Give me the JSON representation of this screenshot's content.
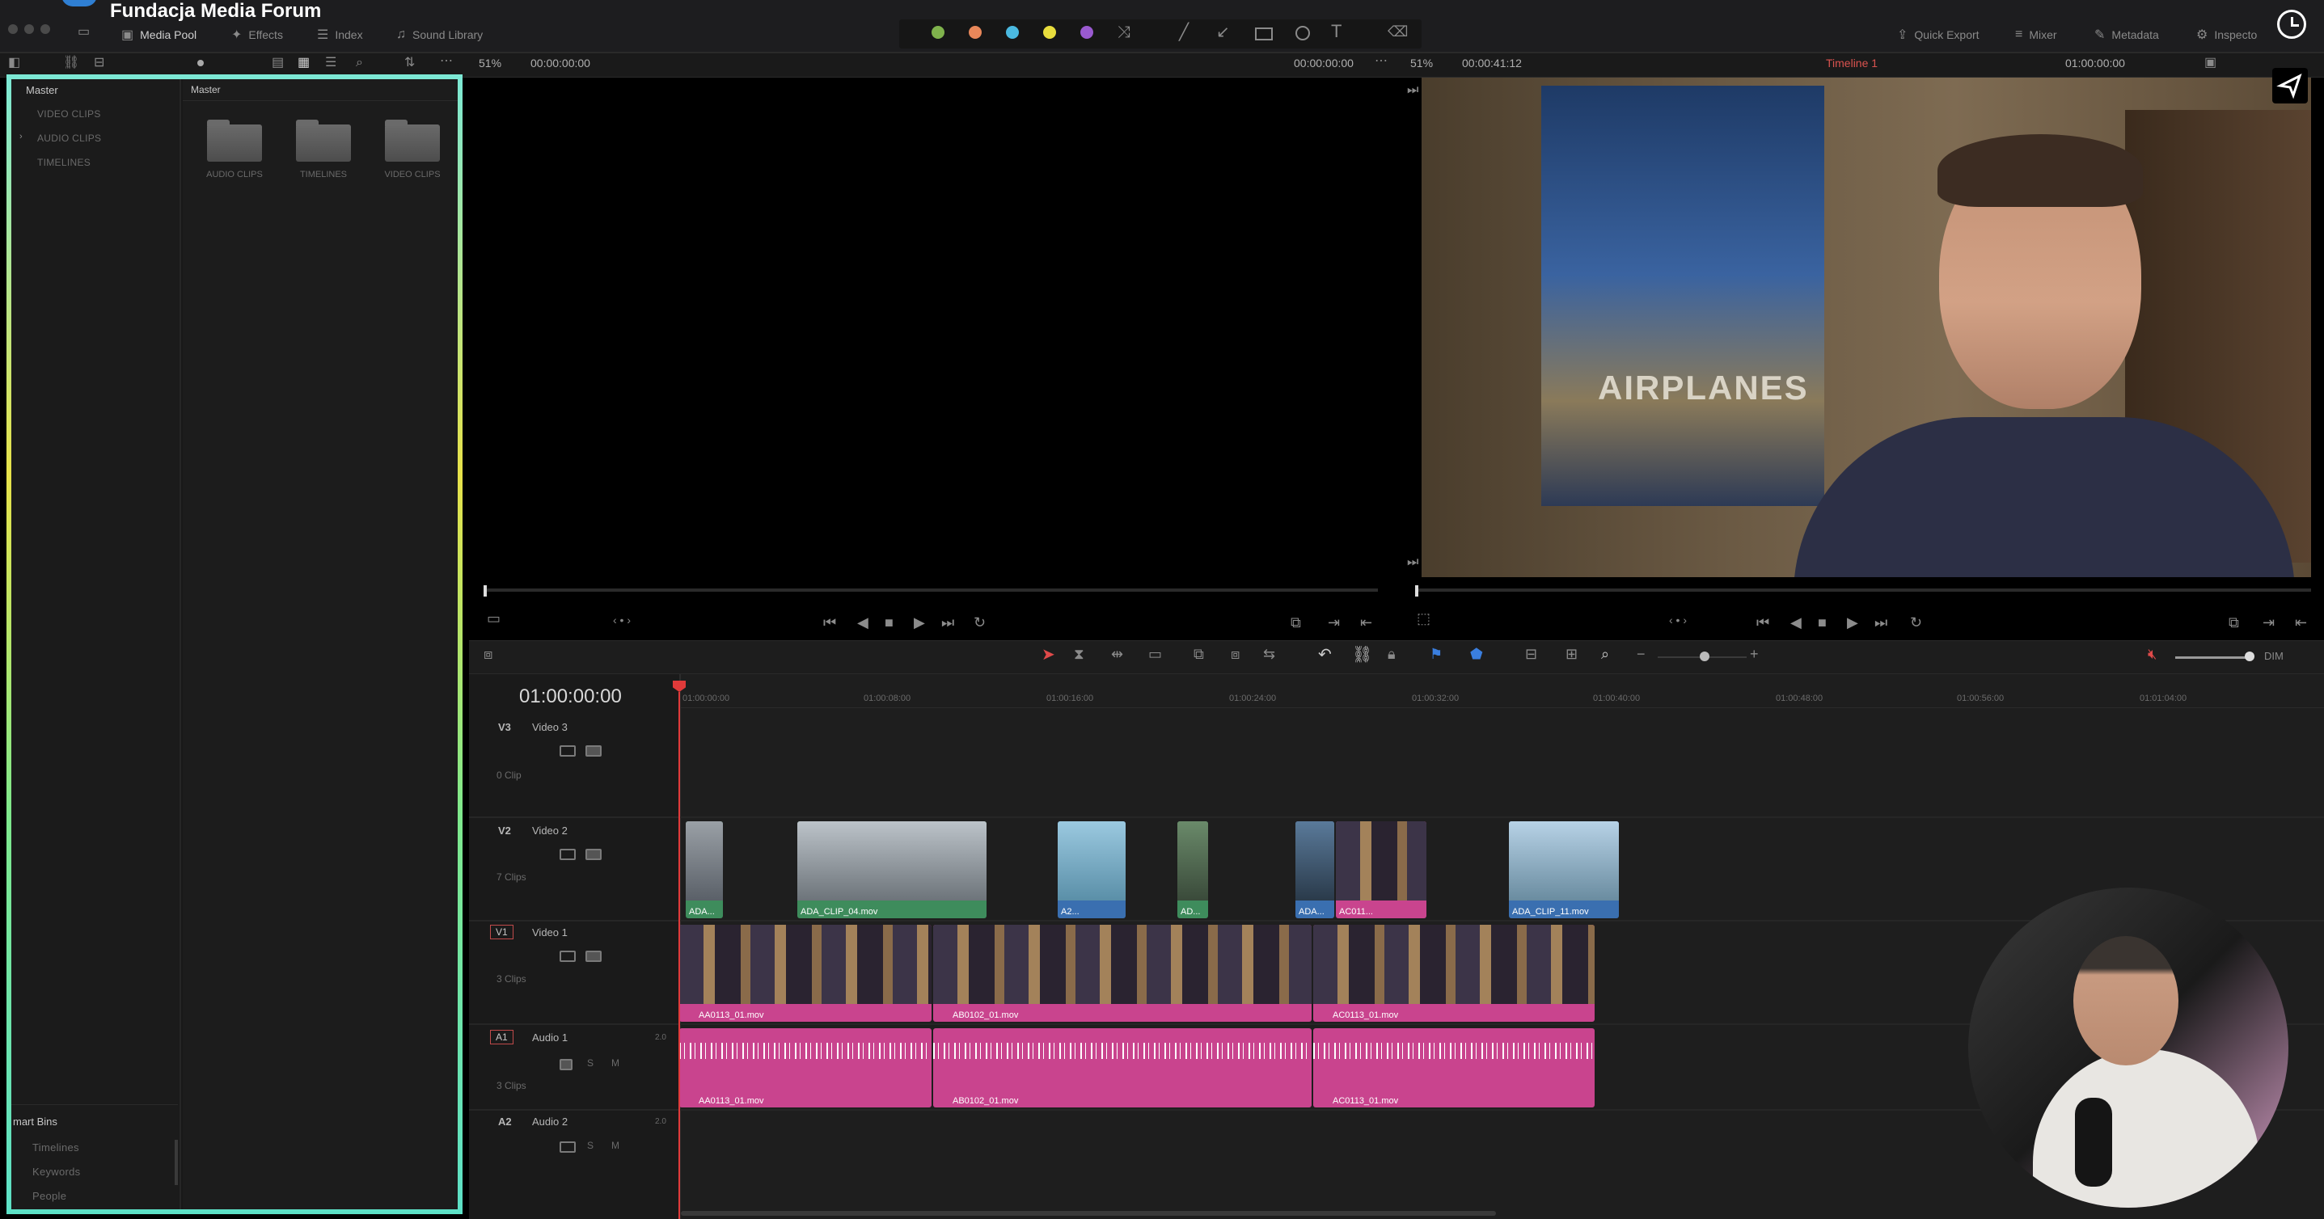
{
  "brand": "Fundacja Media Forum",
  "topbar": {
    "tabs_left": [
      {
        "label": "Media Pool",
        "icon": "media-pool-icon",
        "active": true
      },
      {
        "label": "Effects",
        "icon": "effects-icon"
      },
      {
        "label": "Index",
        "icon": "index-icon"
      },
      {
        "label": "Sound Library",
        "icon": "sound-library-icon"
      }
    ],
    "tabs_right": [
      {
        "label": "Quick Export",
        "icon": "export-icon"
      },
      {
        "label": "Mixer",
        "icon": "mixer-icon"
      },
      {
        "label": "Metadata",
        "icon": "metadata-icon"
      },
      {
        "label": "Inspecto",
        "icon": "inspector-icon"
      }
    ],
    "flag_colors": [
      "#7fb24c",
      "#e8875a",
      "#4ab9e0",
      "#e8dd3d",
      "#9a5ad0"
    ]
  },
  "source_viewer": {
    "zoom": "51%",
    "timecode_left": "00:00:00:00",
    "timecode_right": "00:00:00:00"
  },
  "program_viewer": {
    "zoom": "51%",
    "duration": "00:00:41:12",
    "timeline_name": "Timeline 1",
    "timecode": "01:00:00:00"
  },
  "media_pool": {
    "master_label": "Master",
    "bins": [
      "VIDEO CLIPS",
      "AUDIO CLIPS",
      "TIMELINES"
    ],
    "content_title": "Master",
    "folders": [
      "AUDIO CLIPS",
      "TIMELINES",
      "VIDEO CLIPS"
    ],
    "smart_bins_title": "mart Bins",
    "smart_bins": [
      "Timelines",
      "Keywords",
      "People"
    ]
  },
  "timeline": {
    "timecode": "01:00:00:00",
    "ruler": [
      "01:00:00:00",
      "01:00:08:00",
      "01:00:16:00",
      "01:00:24:00",
      "01:00:32:00",
      "01:00:40:00",
      "01:00:48:00",
      "01:00:56:00",
      "01:01:04:00"
    ],
    "dim_label": "DIM",
    "tracks": [
      {
        "id": "V3",
        "name": "Video 3",
        "clips": "0 Clip"
      },
      {
        "id": "V2",
        "name": "Video 2",
        "clips": "7 Clips"
      },
      {
        "id": "V1",
        "name": "Video 1",
        "clips": "3 Clips"
      },
      {
        "id": "A1",
        "name": "Audio 1",
        "clips": "3 Clips",
        "ch": "2.0"
      },
      {
        "id": "A2",
        "name": "Audio 2",
        "clips": "",
        "ch": "2.0"
      }
    ],
    "v2_clips": [
      "ADA...",
      "ADA_CLIP_04.mov",
      "A2...",
      "AD...",
      "ADA...",
      "AC011...",
      "ADA_CLIP_11.mov"
    ],
    "v1_clips": [
      "AA0113_01.mov",
      "AB0102_01.mov",
      "AC0113_01.mov"
    ],
    "a1_clips": [
      "AA0113_01.mov",
      "AB0102_01.mov",
      "AC0113_01.mov"
    ],
    "colors": {
      "pink": "#c9448e",
      "green": "#3e8c5c",
      "blue": "#3a6fb0"
    }
  }
}
